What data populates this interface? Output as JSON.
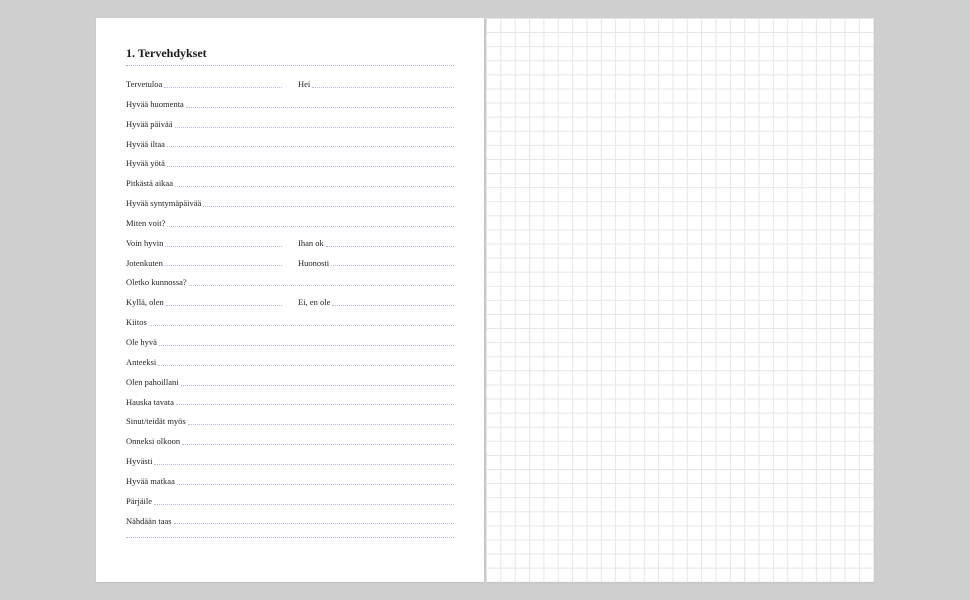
{
  "heading": "1. Tervehdykset",
  "rows": [
    {
      "cols": [
        "Tervetuloa",
        "Hei"
      ]
    },
    {
      "cols": [
        "Hyvää huomenta"
      ]
    },
    {
      "cols": [
        "Hyvää päivää"
      ]
    },
    {
      "cols": [
        "Hyvää iltaa"
      ]
    },
    {
      "cols": [
        "Hyvää yötä"
      ]
    },
    {
      "cols": [
        "Pitkästä aikaa"
      ]
    },
    {
      "cols": [
        "Hyvää syntymäpäivää"
      ]
    },
    {
      "cols": [
        "Miten voit?"
      ]
    },
    {
      "cols": [
        "Voin hyvin",
        "Ihan ok"
      ]
    },
    {
      "cols": [
        "Jotenkuten",
        "Huonosti"
      ]
    },
    {
      "cols": [
        "Oletko kunnossa?"
      ]
    },
    {
      "cols": [
        "Kyllä, olen",
        "Ei, en ole"
      ]
    },
    {
      "cols": [
        "Kiitos"
      ]
    },
    {
      "cols": [
        "Ole hyvä"
      ]
    },
    {
      "cols": [
        "Anteeksi"
      ]
    },
    {
      "cols": [
        "Olen pahoillani"
      ]
    },
    {
      "cols": [
        "Hauska tavata"
      ]
    },
    {
      "cols": [
        "Sinut/teidät myös"
      ]
    },
    {
      "cols": [
        "Onneksi olkoon"
      ]
    },
    {
      "cols": [
        "Hyvästi"
      ]
    },
    {
      "cols": [
        "Hyvää matkaa"
      ]
    },
    {
      "cols": [
        "Pärjäile"
      ]
    },
    {
      "cols": [
        "Nähdään taas"
      ]
    }
  ]
}
